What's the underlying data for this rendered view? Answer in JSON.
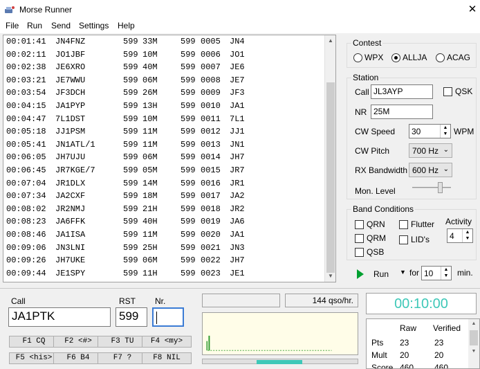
{
  "window": {
    "title": "Morse Runner",
    "close_glyph": "✕"
  },
  "menu": [
    "File",
    "Run",
    "Send",
    "Settings",
    "Help"
  ],
  "log": [
    {
      "time": "00:01:41",
      "call": "JN4FNZ",
      "rst": "599",
      "exch": "33M",
      "rst2": "599",
      "nr": "0005",
      "pfx": "JN4"
    },
    {
      "time": "00:02:11",
      "call": "JO1JBF",
      "rst": "599",
      "exch": "10M",
      "rst2": "599",
      "nr": "0006",
      "pfx": "JO1"
    },
    {
      "time": "00:02:38",
      "call": "JE6XRO",
      "rst": "599",
      "exch": "40M",
      "rst2": "599",
      "nr": "0007",
      "pfx": "JE6"
    },
    {
      "time": "00:03:21",
      "call": "JE7WWU",
      "rst": "599",
      "exch": "06M",
      "rst2": "599",
      "nr": "0008",
      "pfx": "JE7"
    },
    {
      "time": "00:03:54",
      "call": "JF3DCH",
      "rst": "599",
      "exch": "26M",
      "rst2": "599",
      "nr": "0009",
      "pfx": "JF3"
    },
    {
      "time": "00:04:15",
      "call": "JA1PYP",
      "rst": "599",
      "exch": "13H",
      "rst2": "599",
      "nr": "0010",
      "pfx": "JA1"
    },
    {
      "time": "00:04:47",
      "call": "7L1DST",
      "rst": "599",
      "exch": "10M",
      "rst2": "599",
      "nr": "0011",
      "pfx": "7L1"
    },
    {
      "time": "00:05:18",
      "call": "JJ1PSM",
      "rst": "599",
      "exch": "11M",
      "rst2": "599",
      "nr": "0012",
      "pfx": "JJ1"
    },
    {
      "time": "00:05:41",
      "call": "JN1ATL/1",
      "rst": "599",
      "exch": "11M",
      "rst2": "599",
      "nr": "0013",
      "pfx": "JN1"
    },
    {
      "time": "00:06:05",
      "call": "JH7UJU",
      "rst": "599",
      "exch": "06M",
      "rst2": "599",
      "nr": "0014",
      "pfx": "JH7"
    },
    {
      "time": "00:06:45",
      "call": "JR7KGE/7",
      "rst": "599",
      "exch": "05M",
      "rst2": "599",
      "nr": "0015",
      "pfx": "JR7"
    },
    {
      "time": "00:07:04",
      "call": "JR1DLX",
      "rst": "599",
      "exch": "14M",
      "rst2": "599",
      "nr": "0016",
      "pfx": "JR1"
    },
    {
      "time": "00:07:34",
      "call": "JA2CXF",
      "rst": "599",
      "exch": "18M",
      "rst2": "599",
      "nr": "0017",
      "pfx": "JA2"
    },
    {
      "time": "00:08:02",
      "call": "JR2NMJ",
      "rst": "599",
      "exch": "21H",
      "rst2": "599",
      "nr": "0018",
      "pfx": "JR2"
    },
    {
      "time": "00:08:23",
      "call": "JA6FFK",
      "rst": "599",
      "exch": "40H",
      "rst2": "599",
      "nr": "0019",
      "pfx": "JA6"
    },
    {
      "time": "00:08:46",
      "call": "JA1ISA",
      "rst": "599",
      "exch": "11M",
      "rst2": "599",
      "nr": "0020",
      "pfx": "JA1"
    },
    {
      "time": "00:09:06",
      "call": "JN3LNI",
      "rst": "599",
      "exch": "25H",
      "rst2": "599",
      "nr": "0021",
      "pfx": "JN3"
    },
    {
      "time": "00:09:26",
      "call": "JH7UKE",
      "rst": "599",
      "exch": "06M",
      "rst2": "599",
      "nr": "0022",
      "pfx": "JH7"
    },
    {
      "time": "00:09:44",
      "call": "JE1SPY",
      "rst": "599",
      "exch": "11H",
      "rst2": "599",
      "nr": "0023",
      "pfx": "JE1"
    }
  ],
  "contest": {
    "label": "Contest",
    "options": [
      "WPX",
      "ALLJA",
      "ACAG"
    ],
    "selected": "ALLJA"
  },
  "station": {
    "label": "Station",
    "call_label": "Call",
    "call_value": "JL3AYP",
    "qsk_label": "QSK",
    "nr_label": "NR",
    "nr_value": "25M",
    "cw_speed_label": "CW Speed",
    "cw_speed_value": "30",
    "wpm_label": "WPM",
    "cw_pitch_label": "CW Pitch",
    "cw_pitch_value": "700 Hz",
    "rx_bw_label": "RX Bandwidth",
    "rx_bw_value": "600 Hz",
    "mon_level_label": "Mon. Level",
    "mon_level_fraction": 0.75
  },
  "band": {
    "label": "Band Conditions",
    "qrn": "QRN",
    "qrm": "QRM",
    "qsb": "QSB",
    "flutter": "Flutter",
    "lids": "LID's",
    "activity_label": "Activity",
    "activity_value": "4"
  },
  "run": {
    "label": "Run",
    "for_label": "for",
    "minutes_value": "10",
    "min_label": "min."
  },
  "entry": {
    "call_label": "Call",
    "call_value": "JA1PTK",
    "rst_label": "RST",
    "rst_value": "599",
    "nr_label": "Nr.",
    "nr_value": ""
  },
  "fkeys": [
    "F1 CQ",
    "F2 <#>",
    "F3 TU",
    "F4 <my>",
    "F5 <his>",
    "F6 B4",
    "F7 ?",
    "F8 NIL"
  ],
  "rate": {
    "value": "144",
    "unit": "qso/hr."
  },
  "timer": "00:10:00",
  "score": {
    "headers": [
      "",
      "Raw",
      "Verified"
    ],
    "rows": [
      {
        "label": "Pts",
        "raw": "23",
        "verified": "23"
      },
      {
        "label": "Mult",
        "raw": "20",
        "verified": "20"
      },
      {
        "label": "Score",
        "raw": "460",
        "verified": "460"
      }
    ]
  },
  "colors": {
    "accent_timer": "#3ec8b8",
    "scope_bg": "#fffde8",
    "trace": "#2a9a2a",
    "run_icon": "#00a030"
  }
}
